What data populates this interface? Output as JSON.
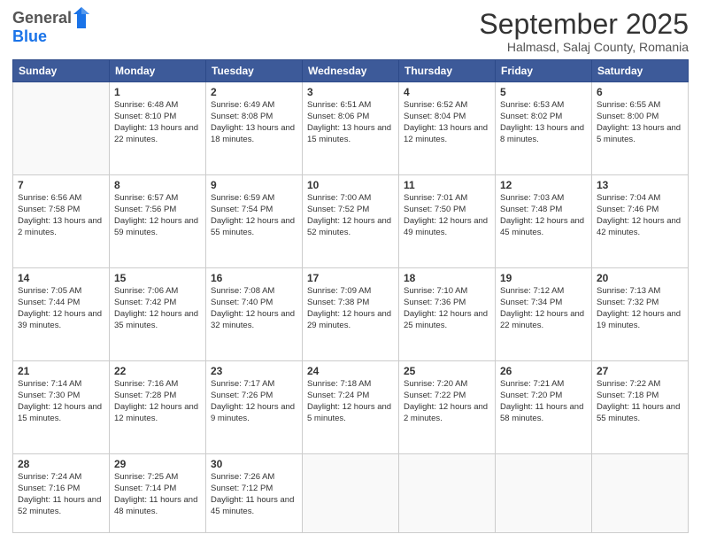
{
  "logo": {
    "general": "General",
    "blue": "Blue"
  },
  "header": {
    "month": "September 2025",
    "location": "Halmasd, Salaj County, Romania"
  },
  "weekdays": [
    "Sunday",
    "Monday",
    "Tuesday",
    "Wednesday",
    "Thursday",
    "Friday",
    "Saturday"
  ],
  "weeks": [
    [
      {
        "day": "",
        "sunrise": "",
        "sunset": "",
        "daylight": ""
      },
      {
        "day": "1",
        "sunrise": "Sunrise: 6:48 AM",
        "sunset": "Sunset: 8:10 PM",
        "daylight": "Daylight: 13 hours and 22 minutes."
      },
      {
        "day": "2",
        "sunrise": "Sunrise: 6:49 AM",
        "sunset": "Sunset: 8:08 PM",
        "daylight": "Daylight: 13 hours and 18 minutes."
      },
      {
        "day": "3",
        "sunrise": "Sunrise: 6:51 AM",
        "sunset": "Sunset: 8:06 PM",
        "daylight": "Daylight: 13 hours and 15 minutes."
      },
      {
        "day": "4",
        "sunrise": "Sunrise: 6:52 AM",
        "sunset": "Sunset: 8:04 PM",
        "daylight": "Daylight: 13 hours and 12 minutes."
      },
      {
        "day": "5",
        "sunrise": "Sunrise: 6:53 AM",
        "sunset": "Sunset: 8:02 PM",
        "daylight": "Daylight: 13 hours and 8 minutes."
      },
      {
        "day": "6",
        "sunrise": "Sunrise: 6:55 AM",
        "sunset": "Sunset: 8:00 PM",
        "daylight": "Daylight: 13 hours and 5 minutes."
      }
    ],
    [
      {
        "day": "7",
        "sunrise": "Sunrise: 6:56 AM",
        "sunset": "Sunset: 7:58 PM",
        "daylight": "Daylight: 13 hours and 2 minutes."
      },
      {
        "day": "8",
        "sunrise": "Sunrise: 6:57 AM",
        "sunset": "Sunset: 7:56 PM",
        "daylight": "Daylight: 12 hours and 59 minutes."
      },
      {
        "day": "9",
        "sunrise": "Sunrise: 6:59 AM",
        "sunset": "Sunset: 7:54 PM",
        "daylight": "Daylight: 12 hours and 55 minutes."
      },
      {
        "day": "10",
        "sunrise": "Sunrise: 7:00 AM",
        "sunset": "Sunset: 7:52 PM",
        "daylight": "Daylight: 12 hours and 52 minutes."
      },
      {
        "day": "11",
        "sunrise": "Sunrise: 7:01 AM",
        "sunset": "Sunset: 7:50 PM",
        "daylight": "Daylight: 12 hours and 49 minutes."
      },
      {
        "day": "12",
        "sunrise": "Sunrise: 7:03 AM",
        "sunset": "Sunset: 7:48 PM",
        "daylight": "Daylight: 12 hours and 45 minutes."
      },
      {
        "day": "13",
        "sunrise": "Sunrise: 7:04 AM",
        "sunset": "Sunset: 7:46 PM",
        "daylight": "Daylight: 12 hours and 42 minutes."
      }
    ],
    [
      {
        "day": "14",
        "sunrise": "Sunrise: 7:05 AM",
        "sunset": "Sunset: 7:44 PM",
        "daylight": "Daylight: 12 hours and 39 minutes."
      },
      {
        "day": "15",
        "sunrise": "Sunrise: 7:06 AM",
        "sunset": "Sunset: 7:42 PM",
        "daylight": "Daylight: 12 hours and 35 minutes."
      },
      {
        "day": "16",
        "sunrise": "Sunrise: 7:08 AM",
        "sunset": "Sunset: 7:40 PM",
        "daylight": "Daylight: 12 hours and 32 minutes."
      },
      {
        "day": "17",
        "sunrise": "Sunrise: 7:09 AM",
        "sunset": "Sunset: 7:38 PM",
        "daylight": "Daylight: 12 hours and 29 minutes."
      },
      {
        "day": "18",
        "sunrise": "Sunrise: 7:10 AM",
        "sunset": "Sunset: 7:36 PM",
        "daylight": "Daylight: 12 hours and 25 minutes."
      },
      {
        "day": "19",
        "sunrise": "Sunrise: 7:12 AM",
        "sunset": "Sunset: 7:34 PM",
        "daylight": "Daylight: 12 hours and 22 minutes."
      },
      {
        "day": "20",
        "sunrise": "Sunrise: 7:13 AM",
        "sunset": "Sunset: 7:32 PM",
        "daylight": "Daylight: 12 hours and 19 minutes."
      }
    ],
    [
      {
        "day": "21",
        "sunrise": "Sunrise: 7:14 AM",
        "sunset": "Sunset: 7:30 PM",
        "daylight": "Daylight: 12 hours and 15 minutes."
      },
      {
        "day": "22",
        "sunrise": "Sunrise: 7:16 AM",
        "sunset": "Sunset: 7:28 PM",
        "daylight": "Daylight: 12 hours and 12 minutes."
      },
      {
        "day": "23",
        "sunrise": "Sunrise: 7:17 AM",
        "sunset": "Sunset: 7:26 PM",
        "daylight": "Daylight: 12 hours and 9 minutes."
      },
      {
        "day": "24",
        "sunrise": "Sunrise: 7:18 AM",
        "sunset": "Sunset: 7:24 PM",
        "daylight": "Daylight: 12 hours and 5 minutes."
      },
      {
        "day": "25",
        "sunrise": "Sunrise: 7:20 AM",
        "sunset": "Sunset: 7:22 PM",
        "daylight": "Daylight: 12 hours and 2 minutes."
      },
      {
        "day": "26",
        "sunrise": "Sunrise: 7:21 AM",
        "sunset": "Sunset: 7:20 PM",
        "daylight": "Daylight: 11 hours and 58 minutes."
      },
      {
        "day": "27",
        "sunrise": "Sunrise: 7:22 AM",
        "sunset": "Sunset: 7:18 PM",
        "daylight": "Daylight: 11 hours and 55 minutes."
      }
    ],
    [
      {
        "day": "28",
        "sunrise": "Sunrise: 7:24 AM",
        "sunset": "Sunset: 7:16 PM",
        "daylight": "Daylight: 11 hours and 52 minutes."
      },
      {
        "day": "29",
        "sunrise": "Sunrise: 7:25 AM",
        "sunset": "Sunset: 7:14 PM",
        "daylight": "Daylight: 11 hours and 48 minutes."
      },
      {
        "day": "30",
        "sunrise": "Sunrise: 7:26 AM",
        "sunset": "Sunset: 7:12 PM",
        "daylight": "Daylight: 11 hours and 45 minutes."
      },
      {
        "day": "",
        "sunrise": "",
        "sunset": "",
        "daylight": ""
      },
      {
        "day": "",
        "sunrise": "",
        "sunset": "",
        "daylight": ""
      },
      {
        "day": "",
        "sunrise": "",
        "sunset": "",
        "daylight": ""
      },
      {
        "day": "",
        "sunrise": "",
        "sunset": "",
        "daylight": ""
      }
    ]
  ]
}
